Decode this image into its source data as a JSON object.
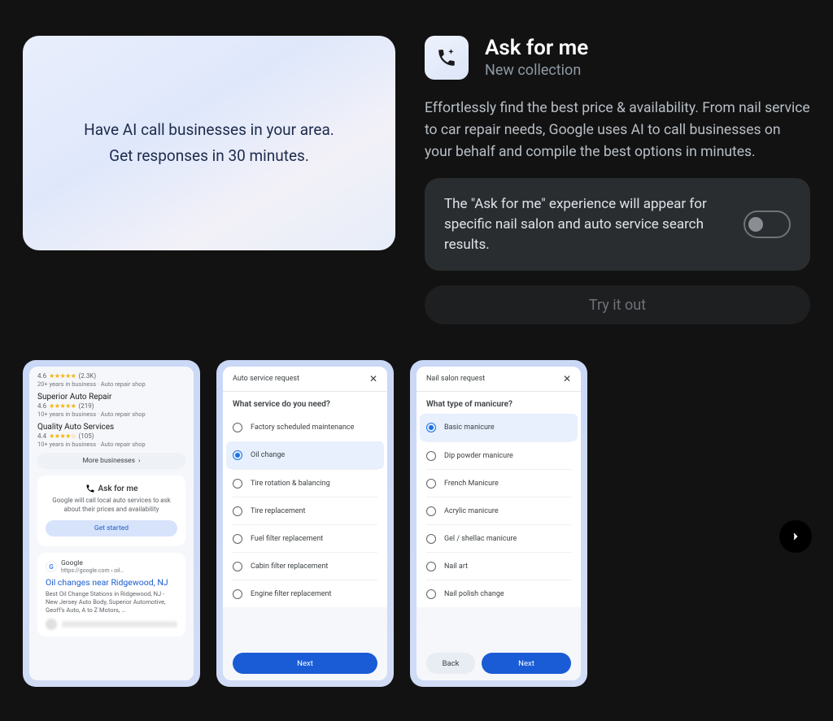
{
  "promo": {
    "line1": "Have AI call businesses in your area.",
    "line2": "Get responses in 30 minutes."
  },
  "header": {
    "title": "Ask for me",
    "subtitle": "New collection"
  },
  "description": "Effortlessly find the best price & availability. From nail service to car repair needs, Google uses AI to call businesses on your behalf and compile the best options in minutes.",
  "toggle": {
    "text": "The \"Ask for me\" experience will appear for specific nail salon and auto service search results.",
    "on": false
  },
  "try_button": "Try it out",
  "phone1": {
    "biz0": {
      "rating": "4.6",
      "stars": "★★★★★",
      "count": "(2.3K)",
      "meta": "20+ years in business · Auto repair shop"
    },
    "biz1": {
      "name": "Superior Auto Repair",
      "rating": "4.6",
      "stars": "★★★★★",
      "count": "(219)",
      "meta": "10+ years in business · Auto repair shop"
    },
    "biz2": {
      "name": "Quality Auto Services",
      "rating": "4.4",
      "stars": "★★★★☆",
      "count": "(105)",
      "meta": "10+ years in business · Auto repair shop"
    },
    "more": "More businesses",
    "afm_title": "Ask for me",
    "afm_sub": "Google will call local auto services to ask about their prices and availability",
    "get_started": "Get started",
    "source_name": "Google",
    "source_url": "https://google.com › oil…",
    "result_title": "Oil changes near Ridgewood, NJ",
    "result_desc": "Best Oil Change Stations in Ridgewood, NJ - New Jersey Auto Body, Superior Automotive, Geoff's Auto, A to Z Motors, …"
  },
  "phone2": {
    "header": "Auto service request",
    "question": "What service do you need?",
    "options": [
      "Factory scheduled maintenance",
      "Oil change",
      "Tire rotation & balancing",
      "Tire replacement",
      "Fuel filter replacement",
      "Cabin filter replacement",
      "Engine filter replacement"
    ],
    "selected_index": 1,
    "next": "Next"
  },
  "phone3": {
    "header": "Nail salon request",
    "question": "What type of manicure?",
    "options": [
      "Basic manicure",
      "Dip powder manicure",
      "French Manicure",
      "Acrylic manicure",
      "Gel / shellac manicure",
      "Nail art",
      "Nail polish change"
    ],
    "selected_index": 0,
    "back": "Back",
    "next": "Next"
  }
}
